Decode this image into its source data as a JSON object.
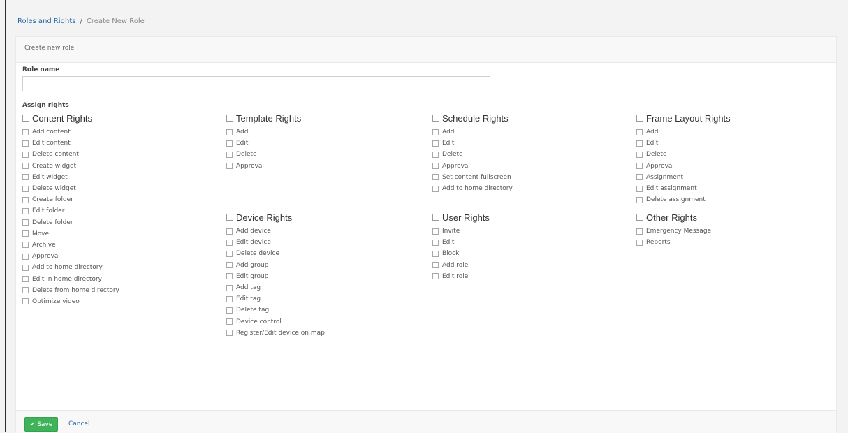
{
  "breadcrumb": {
    "parent": "Roles and Rights",
    "separator": "/",
    "current": "Create New Role"
  },
  "panel": {
    "title": "Create new role"
  },
  "form": {
    "role_name_label": "Role name",
    "role_name_value": "",
    "assign_label": "Assign rights"
  },
  "groups": [
    {
      "title": "Content Rights",
      "items": [
        "Add content",
        "Edit content",
        "Delete content",
        "Create widget",
        "Edit widget",
        "Delete widget",
        "Create folder",
        "Edit folder",
        "Delete folder",
        "Move",
        "Archive",
        "Approval",
        "Add to home directory",
        "Edit in home directory",
        "Delete from home directory",
        "Optimize video"
      ]
    },
    {
      "title": "Template Rights",
      "items": [
        "Add",
        "Edit",
        "Delete",
        "Approval"
      ]
    },
    {
      "title": "Schedule Rights",
      "items": [
        "Add",
        "Edit",
        "Delete",
        "Approval",
        "Set content fullscreen",
        "Add to home directory"
      ]
    },
    {
      "title": "Frame Layout Rights",
      "items": [
        "Add",
        "Edit",
        "Delete",
        "Approval",
        "Assignment",
        "Edit assignment",
        "Delete assignment"
      ]
    },
    {
      "title": "Device Rights",
      "items": [
        "Add device",
        "Edit device",
        "Delete device",
        "Add group",
        "Edit group",
        "Add tag",
        "Edit tag",
        "Delete tag",
        "Device control",
        "Register/Edit device on map"
      ]
    },
    {
      "title": "User Rights",
      "items": [
        "Invite",
        "Edit",
        "Block",
        "Add role",
        "Edit role"
      ]
    },
    {
      "title": "Other Rights",
      "items": [
        "Emergency Message",
        "Reports"
      ]
    }
  ],
  "footer": {
    "save_icon": "check-icon",
    "save_label": "Save",
    "cancel_label": "Cancel"
  },
  "colors": {
    "accent_link": "#2a6aa8",
    "save_button": "#3fb35a"
  }
}
